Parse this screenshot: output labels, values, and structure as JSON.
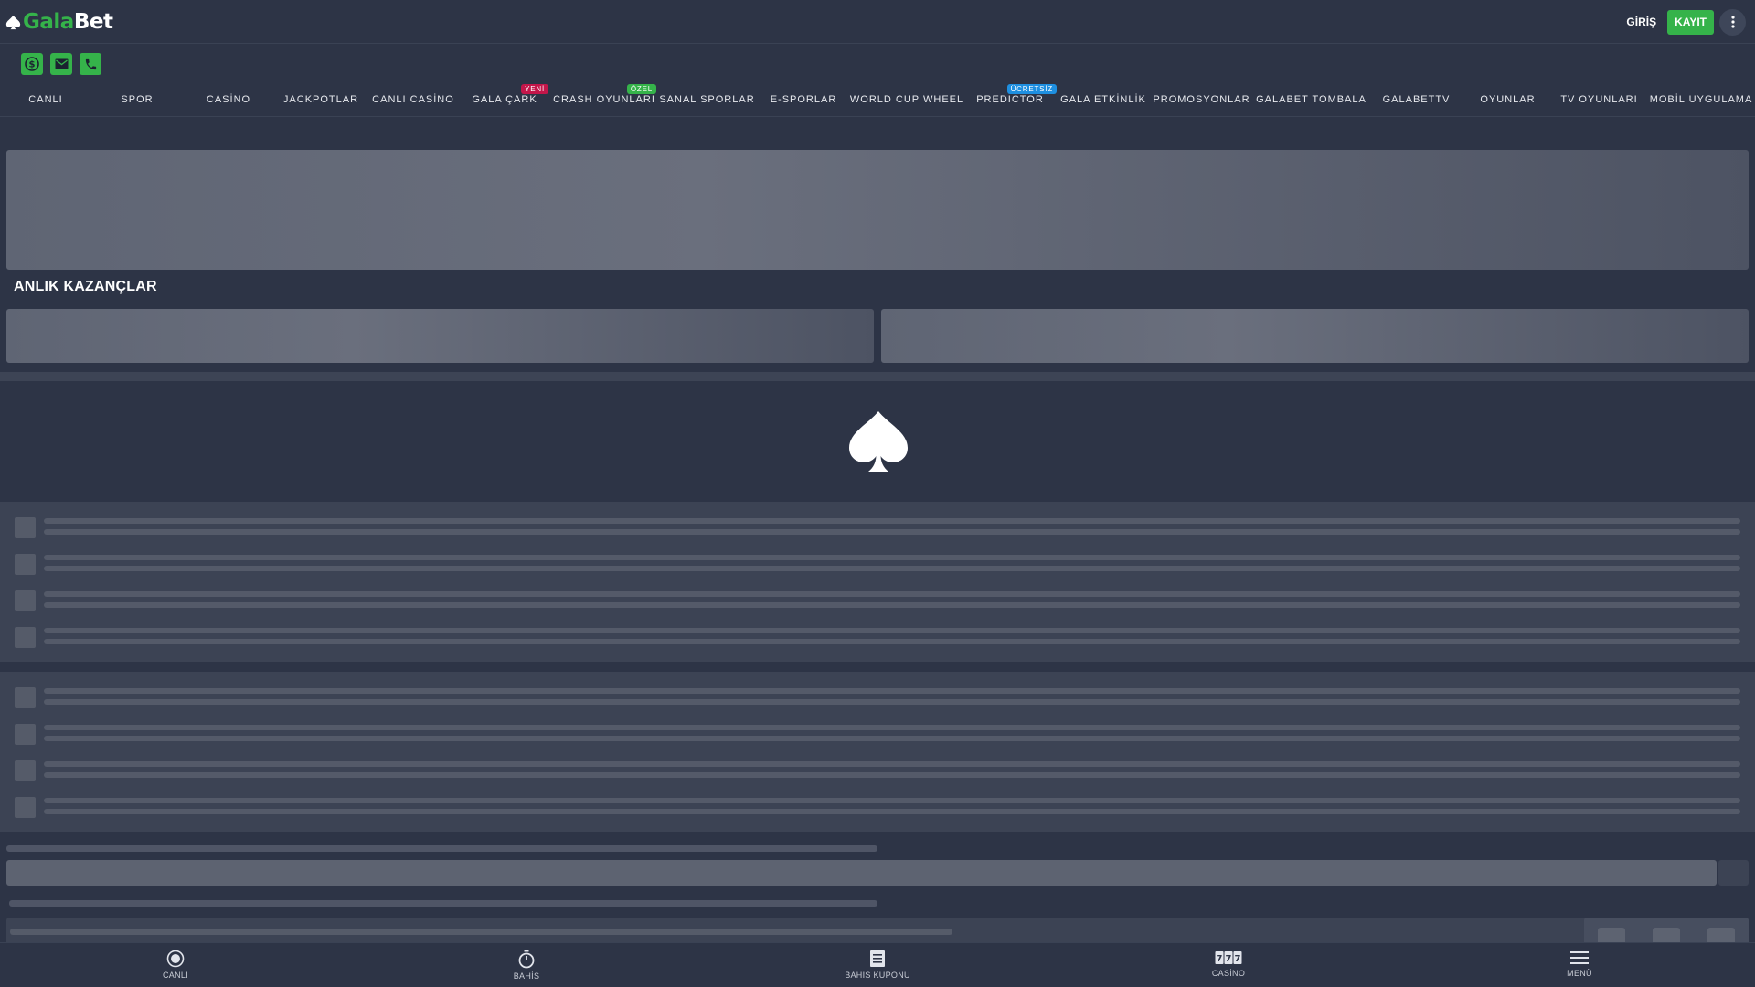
{
  "header": {
    "logo_part1": "Gala",
    "logo_part2": "Bet",
    "login_label": "GİRİŞ",
    "register_label": "KAYIT",
    "more_icon": "more-vertical-icon"
  },
  "contact": {
    "icons": [
      "dollar-icon",
      "mail-icon",
      "phone-icon"
    ]
  },
  "nav": {
    "items": [
      {
        "label": "CANLI"
      },
      {
        "label": "SPOR"
      },
      {
        "label": "CASİNO"
      },
      {
        "label": "JACKPOTLAR"
      },
      {
        "label": "CANLI CASİNO"
      },
      {
        "label": "GALA ÇARK",
        "badge": "YENİ"
      },
      {
        "label": "CRASH OYUNLARI",
        "badge": "ÖZEL"
      },
      {
        "label": "SANAL SPORLAR"
      },
      {
        "label": "E-SPORLAR"
      },
      {
        "label": "WORLD CUP WHEEL"
      },
      {
        "label": "PREDICTOR",
        "badge": "ÜCRETSİZ"
      },
      {
        "label": "GALA ETKİNLİK"
      },
      {
        "label": "PROMOSYONLAR"
      },
      {
        "label": "GALABET TOMBALA"
      },
      {
        "label": "GALABETTV"
      },
      {
        "label": "OYUNLAR"
      },
      {
        "label": "TV OYUNLARI"
      },
      {
        "label": "MOBİL UYGULAMA"
      }
    ]
  },
  "main": {
    "section_title": "ANLIK KAZANÇLAR"
  },
  "bottom_nav": {
    "items": [
      {
        "label": "CANLI",
        "icon": "live-icon"
      },
      {
        "label": "BAHİS",
        "icon": "stopwatch-icon"
      },
      {
        "label": "BAHİS KUPONU",
        "icon": "betslip-icon"
      },
      {
        "label": "CASİNO",
        "icon": "slot-777-icon"
      },
      {
        "label": "MENÜ",
        "icon": "menu-icon"
      }
    ]
  },
  "colors": {
    "background": "#2d3446",
    "brand_green": "#35b34a",
    "badge_new": "#c3164a",
    "badge_free": "#1e8fe0"
  }
}
